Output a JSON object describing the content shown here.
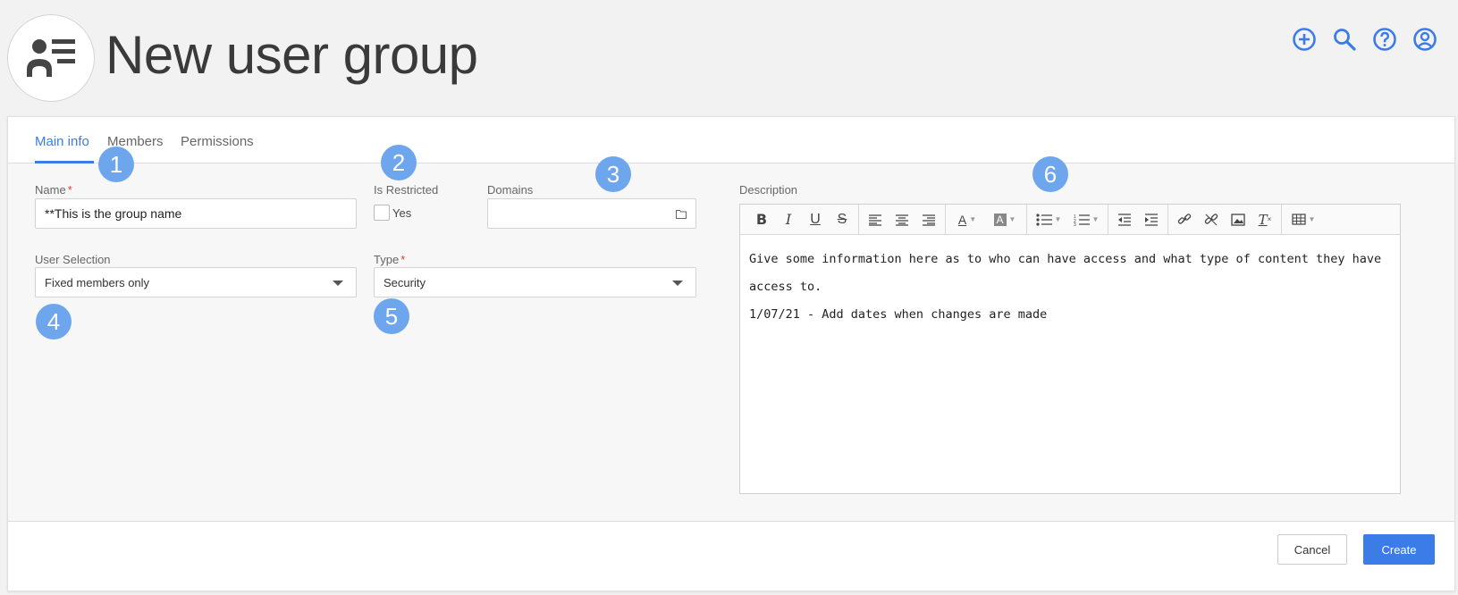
{
  "header": {
    "title": "New user group",
    "icon": "user-list-icon",
    "actions": [
      {
        "name": "add-icon"
      },
      {
        "name": "search-icon"
      },
      {
        "name": "help-icon"
      },
      {
        "name": "account-icon"
      }
    ]
  },
  "tabs": [
    {
      "label": "Main info",
      "active": true
    },
    {
      "label": "Members",
      "active": false
    },
    {
      "label": "Permissions",
      "active": false
    }
  ],
  "form": {
    "name_label": "Name",
    "name_value": "**This is the group name",
    "restricted_label": "Is Restricted",
    "restricted_option": "Yes",
    "restricted_checked": false,
    "domains_label": "Domains",
    "domains_value": "",
    "user_selection_label": "User Selection",
    "user_selection_value": "Fixed members only",
    "type_label": "Type",
    "type_value": "Security",
    "description_label": "Description",
    "description_lines": [
      "Give some information here as to who can have access and what type of content they have access to.",
      "1/07/21 - Add dates when changes are made"
    ]
  },
  "badges": [
    "1",
    "2",
    "3",
    "4",
    "5",
    "6"
  ],
  "footer": {
    "cancel_label": "Cancel",
    "create_label": "Create"
  },
  "colors": {
    "accent": "#3b7ce8",
    "badge": "#6ea6ee",
    "required": "#e53935"
  }
}
